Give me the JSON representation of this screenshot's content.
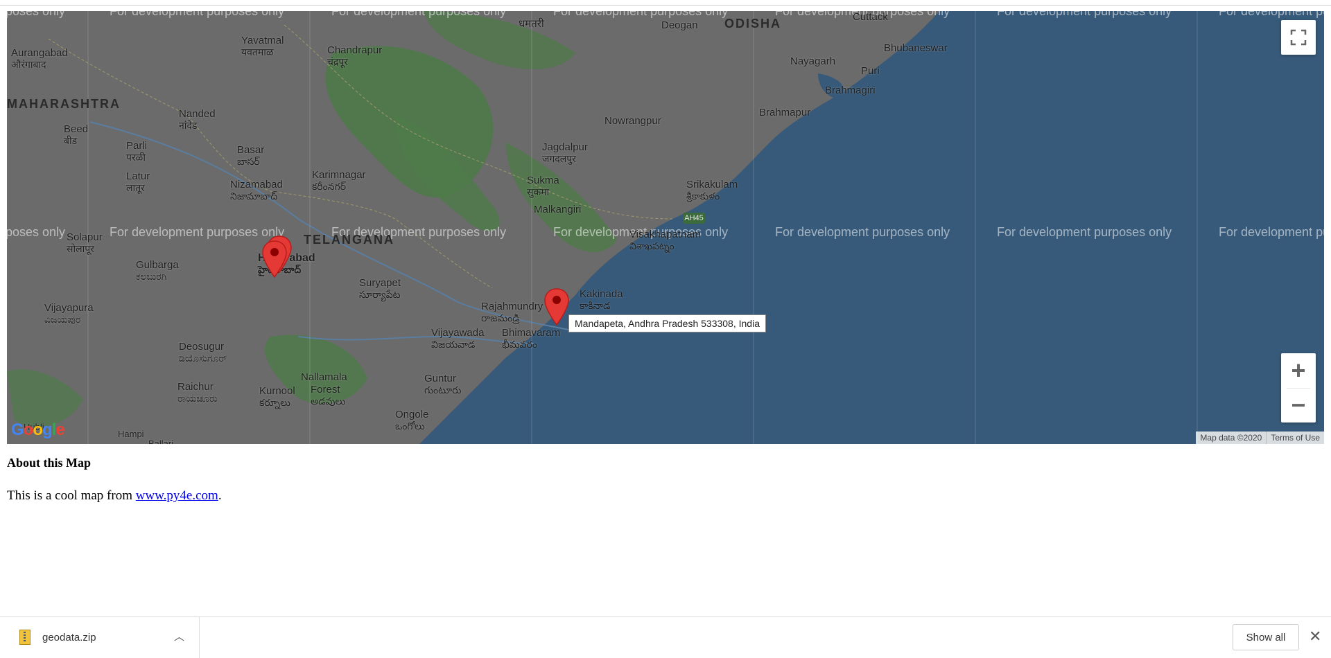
{
  "map": {
    "watermark": "For development purposes only",
    "places": [
      {
        "id": "aurangabad",
        "name": "Aurangabad",
        "local": "औरंगाबाद"
      },
      {
        "id": "yavatmal",
        "name": "Yavatmal",
        "local": "यवतमाळ"
      },
      {
        "id": "chandrapur",
        "name": "Chandrapur",
        "local": "चंद्रपूर"
      },
      {
        "id": "dhamtari",
        "name": "",
        "local": "धमतरी"
      },
      {
        "id": "deogan",
        "name": "Deogan",
        "local": ""
      },
      {
        "id": "cuttack",
        "name": "Cuttack",
        "local": ""
      },
      {
        "id": "bhubaneswar",
        "name": "Bhubaneswar",
        "local": ""
      },
      {
        "id": "nayagarh",
        "name": "Nayagarh",
        "local": ""
      },
      {
        "id": "puri",
        "name": "Puri",
        "local": ""
      },
      {
        "id": "brahmagiri",
        "name": "Brahmagiri",
        "local": ""
      },
      {
        "id": "brahmapur",
        "name": "Brahmapur",
        "local": ""
      },
      {
        "id": "nanded",
        "name": "Nanded",
        "local": "नांदेड"
      },
      {
        "id": "beed",
        "name": "Beed",
        "local": "बीड"
      },
      {
        "id": "parli",
        "name": "Parli",
        "local": "परळी"
      },
      {
        "id": "basar",
        "name": "Basar",
        "local": "బాసర్"
      },
      {
        "id": "nowrangpur",
        "name": "Nowrangpur",
        "local": ""
      },
      {
        "id": "jagdalpur",
        "name": "Jagdalpur",
        "local": "जगदलपुर"
      },
      {
        "id": "latur",
        "name": "Latur",
        "local": "लातूर"
      },
      {
        "id": "nizamabad",
        "name": "Nizamabad",
        "local": "నిజామాబాద్"
      },
      {
        "id": "karimnagar",
        "name": "Karimnagar",
        "local": "కరీంనగర్"
      },
      {
        "id": "sukma",
        "name": "Sukma",
        "local": "सुकमा"
      },
      {
        "id": "malkangiri",
        "name": "Malkangiri",
        "local": ""
      },
      {
        "id": "srikakulam",
        "name": "Srikakulam",
        "local": "శ్రీకాకుళం"
      },
      {
        "id": "solapur",
        "name": "Solapur",
        "local": "सोलापूर"
      },
      {
        "id": "visakhapatnam",
        "name": "Visakhapatnam",
        "local": "విశాఖపట్నం"
      },
      {
        "id": "hyderabad",
        "name": "Hyderabad",
        "local": "హైదరాబాద్"
      },
      {
        "id": "gulbarga",
        "name": "Gulbarga",
        "local": "ಕಲಬುರಗಿ"
      },
      {
        "id": "suryapet",
        "name": "Suryapet",
        "local": "సూర్యాపేట"
      },
      {
        "id": "kakinada",
        "name": "Kakinada",
        "local": "కాకినాడ"
      },
      {
        "id": "rajahmundry",
        "name": "Rajahmundry",
        "local": "రాజమండ్రి"
      },
      {
        "id": "bhimavaram",
        "name": "Bhimavaram",
        "local": "భీమవరం"
      },
      {
        "id": "vijayapura",
        "name": "Vijayapura",
        "local": "ವಿಜಯಪುರ"
      },
      {
        "id": "vijayawada",
        "name": "Vijayawada",
        "local": "విజయవాడ"
      },
      {
        "id": "deosugur",
        "name": "Deosugur",
        "local": "ಡಿಯೊಸುಗೂರ್"
      },
      {
        "id": "nallamala",
        "name": "Nallamala",
        "local": "నల్లమల"
      },
      {
        "id": "forest",
        "name": "Forest",
        "local": "అడవులు"
      },
      {
        "id": "guntur",
        "name": "Guntur",
        "local": "గుంటూరు"
      },
      {
        "id": "raichur",
        "name": "Raichur",
        "local": "ರಾಯಚೂರು"
      },
      {
        "id": "kurnool",
        "name": "Kurnool",
        "local": "కర్నూలు"
      },
      {
        "id": "ongole",
        "name": "Ongole",
        "local": "ఒంగోలు"
      },
      {
        "id": "hampi",
        "name": "Hampi",
        "local": ""
      },
      {
        "id": "ballari",
        "name": "Ballari",
        "local": ""
      },
      {
        "id": "hubli",
        "name": "Hubli",
        "local": ""
      }
    ],
    "regions": {
      "maharashtra": "MAHARASHTRA",
      "telangana": "TELANGANA",
      "odisha": "ODISHA"
    },
    "highway": "AH45",
    "marker_tooltip": "Mandapeta, Andhra Pradesh 533308, India",
    "google_logo": "Google",
    "attribution": {
      "data": "Map data ©2020",
      "terms": "Terms of Use"
    },
    "zoom": {
      "in": "+",
      "out": "−"
    },
    "colors": {
      "land": "#6b6b6b",
      "forest": "#4f7a4a",
      "water": "#375a7a",
      "marker": "#e53935",
      "marker_dot": "#8b0000"
    }
  },
  "content": {
    "heading": "About this Map",
    "text_before": "This is a cool map from ",
    "link": "www.py4e.com",
    "text_after": "."
  },
  "download_bar": {
    "file": "geodata.zip",
    "show_all": "Show all",
    "close": "✕",
    "chevron": "︿"
  }
}
